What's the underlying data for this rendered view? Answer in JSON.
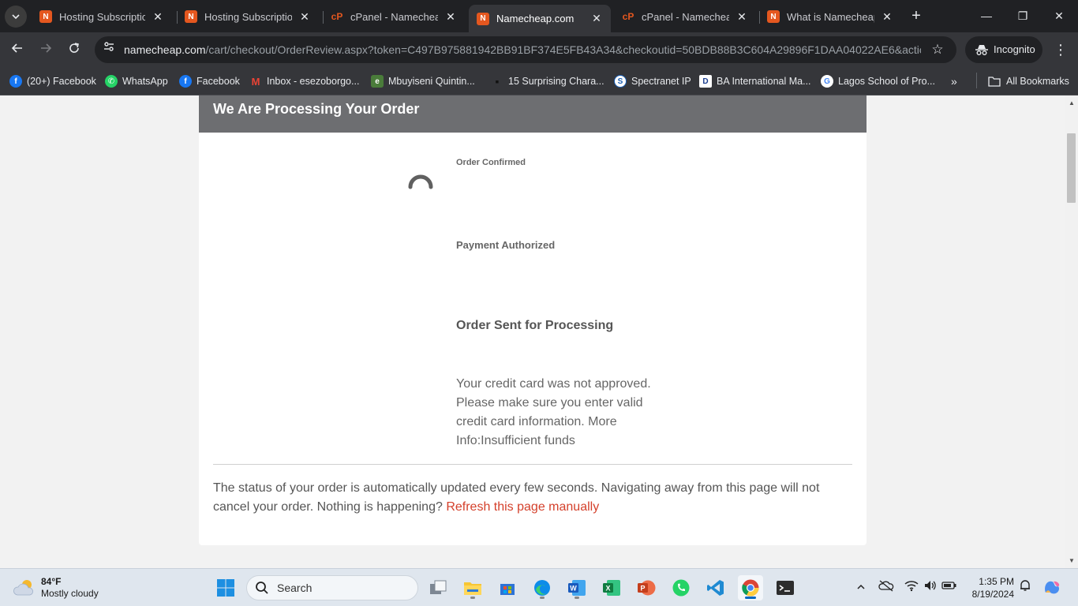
{
  "tabs": [
    {
      "title": "Hosting Subscriptions",
      "favicon": "namecheap",
      "active": false
    },
    {
      "title": "Hosting Subscriptions",
      "favicon": "namecheap",
      "active": false
    },
    {
      "title": "cPanel - Namecheap",
      "favicon": "cpanel",
      "active": false
    },
    {
      "title": "Namecheap.com",
      "favicon": "namecheap",
      "active": true
    },
    {
      "title": "cPanel - Namecheap",
      "favicon": "cpanel",
      "active": false
    },
    {
      "title": "What is Namecheap S",
      "favicon": "namecheap",
      "active": false
    }
  ],
  "address_bar": {
    "host": "namecheap.com",
    "path": "/cart/checkout/OrderReview.aspx?token=C497B975881942BB91BF374E5FB43A34&checkoutid=50BDB88B3C604A29896F1DAA04022AE6&actiont..."
  },
  "profile": {
    "label": "Incognito"
  },
  "bookmarks": [
    {
      "label": "(20+) Facebook",
      "icon": "facebook-icon"
    },
    {
      "label": "WhatsApp",
      "icon": "whatsapp-icon"
    },
    {
      "label": "Facebook",
      "icon": "facebook-icon"
    },
    {
      "label": "Inbox - esezoborgo...",
      "icon": "gmail-icon"
    },
    {
      "label": "Mbuyiseni Quintin...",
      "icon": "site-icon"
    },
    {
      "label": "15 Surprising Chara...",
      "icon": "site-icon"
    },
    {
      "label": "Spectranet IP",
      "icon": "site-icon"
    },
    {
      "label": "BA International Ma...",
      "icon": "site-icon"
    },
    {
      "label": "Lagos School of Pro...",
      "icon": "google-icon"
    }
  ],
  "all_bookmarks": "All Bookmarks",
  "page": {
    "header": "We Are Processing Your Order",
    "steps": [
      "Order Confirmed",
      "Payment Authorized",
      "Order Sent for Processing"
    ],
    "error": "Your credit card was not approved. Please make sure you enter valid credit card information. More Info:Insufficient funds",
    "status_note": "The status of your order is automatically updated every few seconds. Navigating away from this page will not cancel your order. Nothing is happening?",
    "refresh_link": "Refresh this page manually"
  },
  "taskbar": {
    "weather_temp": "84°F",
    "weather_desc": "Mostly cloudy",
    "search_placeholder": "Search",
    "time": "1:35 PM",
    "date": "8/19/2024"
  },
  "colors": {
    "accent": "#d4402b",
    "namecheap": "#e4571f",
    "header_bg": "#6d6e71"
  }
}
